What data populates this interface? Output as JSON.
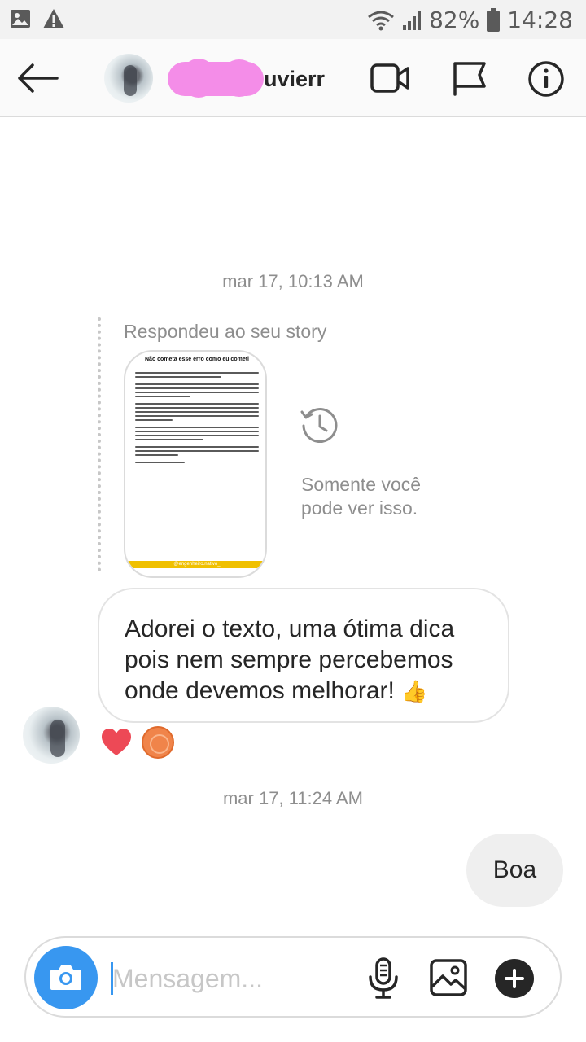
{
  "status_bar": {
    "battery": "82%",
    "time": "14:28",
    "left_icons": [
      "image-icon",
      "warning-icon"
    ],
    "right_icons": [
      "wifi-icon",
      "signal-icon",
      "battery-icon"
    ]
  },
  "header": {
    "username": "uvierr",
    "icons": [
      "back-arrow-icon",
      "video-call-icon",
      "flag-icon",
      "info-icon"
    ]
  },
  "conversation": {
    "timestamp_1": "mar 17, 10:13 AM",
    "story_reply_caption": "Respondeu ao seu story",
    "story": {
      "title": "Não cometa esse erro como eu cometi",
      "handle": "@engenheiro.nativo_"
    },
    "only_you_text": "Somente você pode ver isso.",
    "received_message": "Adorei o texto, uma ótima dica pois nem sempre percebemos onde devemos melhorar!",
    "received_emoji": "👍",
    "reactions": [
      "heart-icon",
      "reactor-avatar"
    ],
    "timestamp_2": "mar 17, 11:24 AM",
    "sent_message": "Boa"
  },
  "composer": {
    "placeholder": "Mensagem...",
    "icons": [
      "camera-icon",
      "microphone-icon",
      "gallery-icon",
      "plus-icon"
    ]
  },
  "colors": {
    "accent": "#3897f0",
    "heart": "#ed4956",
    "story_bar": "#f0c000",
    "timestamp_gray": "#8e8e8e"
  }
}
